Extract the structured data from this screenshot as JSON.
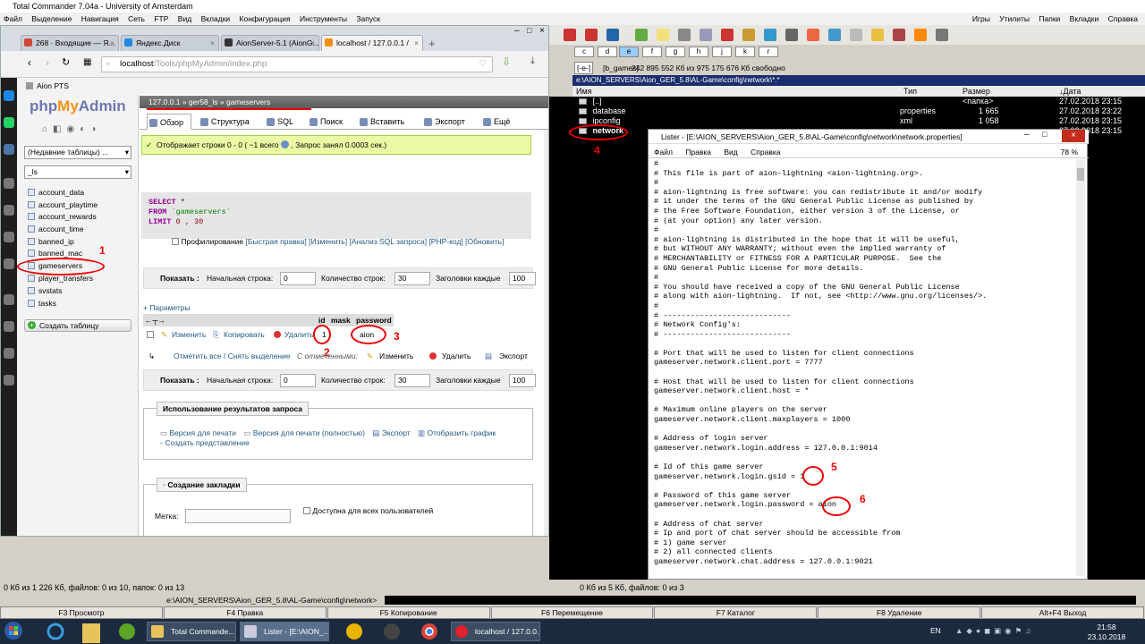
{
  "tc": {
    "title": "Total Commander 7.04a - University of Amsterdam",
    "menu": [
      "Файл",
      "Выделение",
      "Навигация",
      "Сеть",
      "FTP",
      "Вид",
      "Вкладки",
      "Конфигурация",
      "Инструменты",
      "Запуск"
    ],
    "menu_right": [
      "Игры",
      "Утилиты",
      "Папки",
      "Вкладки",
      "Справка"
    ],
    "drives": [
      "c",
      "d",
      "e",
      "f",
      "g",
      "h",
      "j",
      "k",
      "r"
    ],
    "free_drive": "[-e-]",
    "free_label": "[b_games]",
    "free_text": "242 895 552 Кб из 975 175 676 Кб свободно",
    "path": "e:\\AION_SERVERS\\Aion_GER_5.8\\AL-Game\\config\\network\\*.*",
    "headers": {
      "name": "Имя",
      "type": "Тип",
      "size": "Размер",
      "date": "↓Дата"
    },
    "files": [
      {
        "name": "[..]",
        "type": "",
        "size": "<папка>",
        "date": "27.02.2018 23:15"
      },
      {
        "name": "database",
        "type": "properties",
        "size": "1 665",
        "date": "27.02.2018 23:22"
      },
      {
        "name": "ipconfig",
        "type": "xml",
        "size": "1 058",
        "date": "27.02.2018 23:15"
      },
      {
        "name": "network",
        "type": "",
        "size": "",
        "date": "27.02.2018 23:15"
      }
    ],
    "status_left": "0 Кб из 1 226 Кб, файлов: 0 из 10, папок: 0 из 13",
    "status_right": "0 Кб из 5 Кб, файлов: 0 из 3",
    "cmd_path": "e:\\AION_SERVERS\\Aion_GER_5.8\\AL-Game\\config\\network>",
    "fkeys": [
      "F3 Просмотр",
      "F4 Правка",
      "F5 Копирование",
      "F6 Перемещение",
      "F7 Каталог",
      "F8 Удаление",
      "Alt+F4 Выход"
    ]
  },
  "opera": {
    "tabs": [
      {
        "label": "268 · Входящие — Я...",
        "color": "#d14836"
      },
      {
        "label": "Яндекс.Диск",
        "color": "#1e88e5"
      },
      {
        "label": "AionServer-5.1 (AionG...",
        "color": "#333333"
      },
      {
        "label": "localhost / 127.0.0.1 /",
        "color": "#f29111"
      }
    ],
    "url_host": "localhost",
    "url_path": "/Tools/phpMyAdmin/index.php",
    "bookmark": "Aion PTS"
  },
  "pma": {
    "recent_tables": "(Недавние таблицы) ...",
    "db_filter": "_ls",
    "tables": [
      "account_data",
      "account_playtime",
      "account_rewards",
      "account_time",
      "banned_ip",
      "banned_mac",
      "gameservers",
      "player_transfers",
      "svstats",
      "tasks"
    ],
    "create_table": "Создать таблицу",
    "breadcrumb": {
      "server": "127.0.0.1",
      "db": "ger58_ls",
      "table": "gameservers"
    },
    "tabs": [
      "Обзор",
      "Структура",
      "SQL",
      "Поиск",
      "Вставить",
      "Экспорт",
      "Ещё"
    ],
    "success": "Отображает строки 0 - 0  ( ~1 всего",
    "success_tail": ", Запрос занял 0.0003 сек.)",
    "sql": {
      "select": "SELECT",
      "star": "*",
      "from": "FROM",
      "table": "`gameservers`",
      "limit": "LIMIT",
      "limit_val": "0 , 30"
    },
    "profiling": "Профилирование",
    "links": [
      "[Быстрая правка]",
      "[Изменить]",
      "[Анализ SQL запроса]",
      "[PHP-код]",
      "[Обновить]"
    ],
    "show_label": "Показать :",
    "start_label": "Начальная строка:",
    "start_val": "0",
    "count_label": "Количество строк:",
    "count_val": "30",
    "headers_label": "Заголовки каждые",
    "headers_val": "100",
    "params": "+ Параметры",
    "columns": [
      "id",
      "mask",
      "password"
    ],
    "row": {
      "edit": "Изменить",
      "copy": "Копировать",
      "delete": "Удалить",
      "id": "1",
      "mask": "",
      "password": "aion"
    },
    "check_all": "Отметить все / Снять выделение",
    "with_selected": "С отмеченными:",
    "act_edit": "Изменить",
    "act_delete": "Удалить",
    "act_export": "Экспорт",
    "qr_title": "Использование результатов запроса",
    "qr_links": [
      "Версия для печати",
      "Версия для печати (полностью)",
      "Экспорт",
      "Отобразить график",
      "Создать представление"
    ],
    "bm_title": "Создание закладки",
    "bm_label": "Метка:",
    "bm_public": "Доступна для всех пользователей"
  },
  "lister": {
    "title": "Lister - [E:\\AION_SERVERS\\Aion_GER_5.8\\AL-Game\\config\\network\\network.properties]",
    "menu": [
      "Файл",
      "Правка",
      "Вид",
      "Справка"
    ],
    "zoom": "78 %",
    "lines": [
      "#",
      "# This file is part of aion-lightning <aion-lightning.org>.",
      "#",
      "# aion-lightning is free software: you can redistribute it and/or modify",
      "# it under the terms of the GNU General Public License as published by",
      "# the Free Software Foundation, either version 3 of the License, or",
      "# (at your option) any later version.",
      "#",
      "# aion-lightning is distributed in the hope that it will be useful,",
      "# but WITHOUT ANY WARRANTY; without even the implied warranty of",
      "# MERCHANTABILITY or FITNESS FOR A PARTICULAR PURPOSE.  See the",
      "# GNU General Public License for more details.",
      "#",
      "# You should have received a copy of the GNU General Public License",
      "# along with aion-lightning.  If not, see <http://www.gnu.org/licenses/>.",
      "#",
      "# ----------------------------",
      "# Network Config's:",
      "# ----------------------------",
      "",
      "# Port that will be used to listen for client connections",
      "gameserver.network.client.port = 7777",
      "",
      "# Host that will be used to listen for client connections",
      "gameserver.network.client.host = *",
      "",
      "# Maximum online players on the server",
      "gameserver.network.client.maxplayers = 1000",
      "",
      "# Address of login server",
      "gameserver.network.login.address = 127.0.0.1:9014",
      "",
      "# Id of this game server",
      "gameserver.network.login.gsid = 1",
      "",
      "# Password of this game server",
      "gameserver.network.login.password = aion",
      "",
      "# Address of chat server",
      "# Ip and port of chat server should be accessible from",
      "# 1) game server",
      "# 2) all connected clients",
      "gameserver.network.chat.address = 127.0.0.1:9021"
    ]
  },
  "annotations": [
    "1",
    "2",
    "3",
    "4",
    "5",
    "6"
  ],
  "taskbar": {
    "buttons": [
      "Total Commande...",
      "Lister - [E:\\AION_...",
      "localhost / 127.0.0..."
    ],
    "lang": "EN",
    "time": "21:58",
    "date": "23.10.2018"
  }
}
